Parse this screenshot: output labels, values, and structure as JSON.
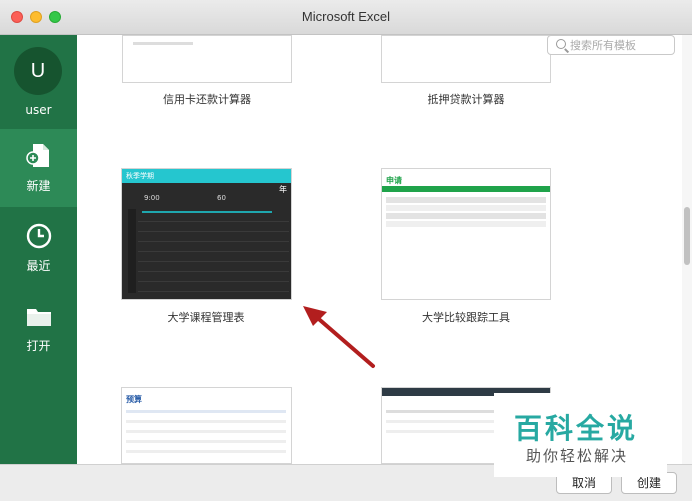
{
  "window": {
    "title": "Microsoft Excel"
  },
  "sidebar": {
    "avatar_letter": "U",
    "username": "user",
    "items": [
      {
        "label": "新建",
        "icon": "new-doc-icon",
        "active": true
      },
      {
        "label": "最近",
        "icon": "clock-icon",
        "active": false
      },
      {
        "label": "打开",
        "icon": "folder-icon",
        "active": false
      }
    ]
  },
  "search": {
    "placeholder": "搜索所有模板"
  },
  "templates": [
    {
      "label": "信用卡还款计算器"
    },
    {
      "label": "抵押贷款计算器"
    },
    {
      "label": "大学课程管理表"
    },
    {
      "label": "大学比较跟踪工具"
    },
    {
      "label": ""
    },
    {
      "label": ""
    }
  ],
  "course_thumb": {
    "header": "秋季学期",
    "year": "年",
    "start": "9:00",
    "end": "60"
  },
  "compare_thumb": {
    "title": "申请"
  },
  "budget_thumb": {
    "title": "预算"
  },
  "buttons": {
    "cancel": "取消",
    "create": "创建"
  },
  "watermark": {
    "title": "百科全说",
    "subtitle": "助你轻松解决"
  },
  "colors": {
    "sidebar": "#217346",
    "accent_arrow": "#b21e1e",
    "cyan": "#25c6cf"
  }
}
